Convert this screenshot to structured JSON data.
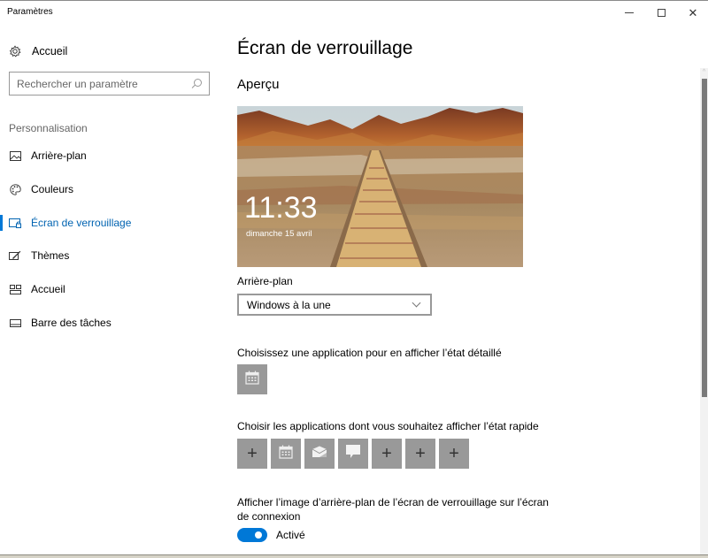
{
  "window": {
    "title": "Paramètres",
    "controls": {
      "minimize": "minimize",
      "maximize": "maximize",
      "close": "✕"
    }
  },
  "sidebar": {
    "home_label": "Accueil",
    "home_icon": "gear-icon",
    "search_placeholder": "Rechercher un paramètre",
    "search_value": "",
    "section_label": "Personnalisation",
    "items": [
      {
        "label": "Arrière-plan",
        "icon": "picture-icon",
        "active": false
      },
      {
        "label": "Couleurs",
        "icon": "palette-icon",
        "active": false
      },
      {
        "label": "Écran de verrouillage",
        "icon": "lock-screen-icon",
        "active": true
      },
      {
        "label": "Thèmes",
        "icon": "themes-icon",
        "active": false
      },
      {
        "label": "Accueil",
        "icon": "start-icon",
        "active": false
      },
      {
        "label": "Barre des tâches",
        "icon": "taskbar-icon",
        "active": false
      }
    ]
  },
  "main": {
    "page_title": "Écran de verrouillage",
    "preview_heading": "Aperçu",
    "preview": {
      "time": "11:33",
      "date": "dimanche 15 avril"
    },
    "background_label": "Arrière-plan",
    "background_value": "Windows à la une",
    "detailed_status_label": "Choisissez une application pour en afficher l’état détaillé",
    "detailed_status_app": "calendar-icon",
    "quick_status_label": "Choisir les applications dont vous souhaitez afficher l’état rapide",
    "quick_status_apps": [
      "plus-icon",
      "calendar-icon",
      "mail-icon",
      "message-icon",
      "plus-icon",
      "plus-icon",
      "plus-icon"
    ],
    "plus_glyph": "+",
    "signin_bg_label": "Afficher l’image d’arrière-plan de l’écran de verrouillage sur l’écran de connexion",
    "signin_bg_toggle": {
      "on": true,
      "label": "Activé"
    },
    "accent_color": "#0078d7"
  }
}
